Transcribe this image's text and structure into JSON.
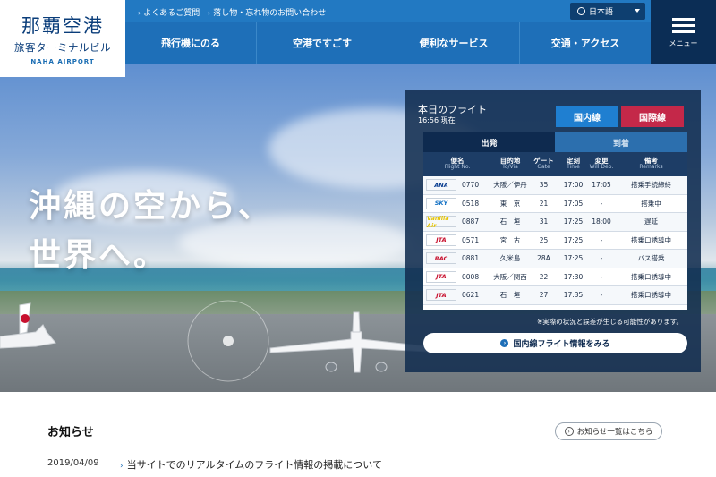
{
  "logo": {
    "title": "那覇空港",
    "subtitle": "旅客ターミナルビル",
    "english": "NAHA AIRPORT"
  },
  "top_links": [
    "よくあるご質問",
    "落し物・忘れ物のお問い合わせ"
  ],
  "language": "日本語",
  "nav": [
    "飛行機にのる",
    "空港ですごす",
    "便利なサービス",
    "交通・アクセス"
  ],
  "menu_label": "メニュー",
  "hero": {
    "line1": "沖縄の空から、",
    "line2": "世界へ。"
  },
  "flights": {
    "title": "本日のフライト",
    "time_now": "16:56 現在",
    "tab_domestic": "国内線",
    "tab_international": "国際線",
    "sub_departure": "出発",
    "sub_arrival": "到着",
    "headers": [
      {
        "ja": "便名",
        "en": "Flight No."
      },
      {
        "ja": "目的地",
        "en": "To/Via"
      },
      {
        "ja": "ゲート",
        "en": "Gate"
      },
      {
        "ja": "定刻",
        "en": "Time"
      },
      {
        "ja": "変更",
        "en": "Will Dep."
      },
      {
        "ja": "備考",
        "en": "Remarks"
      }
    ],
    "rows": [
      {
        "airline": "ANA",
        "airline_color": "#0b3f91",
        "flight": "0770",
        "dest": "大阪／伊丹",
        "gate": "35",
        "time": "17:00",
        "change": "17:05",
        "remarks": "搭乗手続締終"
      },
      {
        "airline": "SKY",
        "airline_color": "#1572c4",
        "flight": "0518",
        "dest": "東　京",
        "gate": "21",
        "time": "17:05",
        "change": "-",
        "remarks": "搭乗中"
      },
      {
        "airline": "Vanilla Air",
        "airline_color": "#e6c400",
        "flight": "0887",
        "dest": "石　垣",
        "gate": "31",
        "time": "17:25",
        "change": "18:00",
        "remarks": "遅延"
      },
      {
        "airline": "JTA",
        "airline_color": "#c8102e",
        "flight": "0571",
        "dest": "宮　古",
        "gate": "25",
        "time": "17:25",
        "change": "-",
        "remarks": "搭乗口誘導中"
      },
      {
        "airline": "RAC",
        "airline_color": "#c8102e",
        "flight": "0881",
        "dest": "久米島",
        "gate": "28A",
        "time": "17:25",
        "change": "-",
        "remarks": "バス搭乗"
      },
      {
        "airline": "JTA",
        "airline_color": "#c8102e",
        "flight": "0008",
        "dest": "大阪／関西",
        "gate": "22",
        "time": "17:30",
        "change": "-",
        "remarks": "搭乗口誘導中"
      },
      {
        "airline": "JTA",
        "airline_color": "#c8102e",
        "flight": "0621",
        "dest": "石　垣",
        "gate": "27",
        "time": "17:35",
        "change": "-",
        "remarks": "搭乗口誘導中"
      }
    ],
    "note": "※実際の状況と誤差が生じる可能性があります。",
    "more_button": "国内線フライト情報をみる"
  },
  "news": {
    "title": "お知らせ",
    "list_button": "お知らせ一覧はこちら",
    "items": [
      {
        "date": "2019/04/09",
        "text": "当サイトでのリアルタイムのフライト情報の掲載について"
      }
    ]
  }
}
